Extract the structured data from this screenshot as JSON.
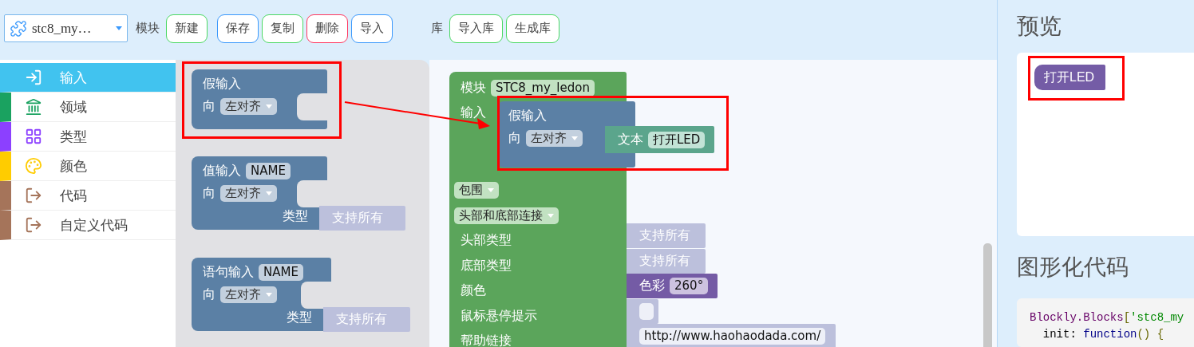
{
  "toolbar": {
    "module_selector": {
      "value": "stc8_my…"
    },
    "module_label": "模块",
    "module_buttons": [
      {
        "label": "新建",
        "color": "#4cd964"
      },
      {
        "label": "保存",
        "color": "#3b99fc"
      },
      {
        "label": "复制",
        "color": "#4cd964"
      },
      {
        "label": "删除",
        "color": "#ff3860"
      },
      {
        "label": "导入",
        "color": "#3b99fc"
      }
    ],
    "library_label": "库",
    "library_buttons": [
      {
        "label": "导入库",
        "color": "#4cd964"
      },
      {
        "label": "生成库",
        "color": "#4cd964"
      }
    ]
  },
  "categories": [
    {
      "label": "输入",
      "color": "#41c3ef",
      "selected": true
    },
    {
      "label": "领域",
      "color": "#1aa260",
      "selected": false
    },
    {
      "label": "类型",
      "color": "#8c40ff",
      "selected": false
    },
    {
      "label": "颜色",
      "color": "#ffcc00",
      "selected": false
    },
    {
      "label": "代码",
      "color": "#a5745a",
      "selected": false
    },
    {
      "label": "自定义代码",
      "color": "#a5745a",
      "selected": false
    }
  ],
  "flyout_blocks": [
    {
      "kind": "dummy",
      "title": "假输入",
      "direction_label": "向",
      "align": "左对齐"
    },
    {
      "kind": "value",
      "title": "值输入",
      "name": "NAME",
      "direction_label": "向",
      "align": "左对齐",
      "type_label": "类型",
      "type_value": "支持所有"
    },
    {
      "kind": "statement",
      "title": "语句输入",
      "name": "NAME",
      "direction_label": "向",
      "align": "左对齐",
      "type_label": "类型",
      "type_value": "支持所有"
    }
  ],
  "factory_block": {
    "title": "模块",
    "name": "STC8_my_ledon",
    "input_label": "输入",
    "input_block": {
      "title": "假输入",
      "direction_label": "向",
      "align": "左对齐",
      "text_block": {
        "label": "文本",
        "value": "打开LED"
      }
    },
    "dropdowns": [
      "包围",
      "头部和底部连接"
    ],
    "rows": [
      {
        "label": "头部类型",
        "kind": "type",
        "value": "支持所有"
      },
      {
        "label": "底部类型",
        "kind": "type",
        "value": "支持所有"
      },
      {
        "label": "颜色",
        "kind": "colour",
        "title": "色彩",
        "value": "260°"
      },
      {
        "label": "鼠标悬停提示",
        "kind": "empty_text"
      },
      {
        "label": "帮助链接",
        "kind": "text",
        "value": "http://www.haohaodada.com/"
      }
    ]
  },
  "preview": {
    "title": "预览",
    "block": "打开LED"
  },
  "code": {
    "title": "图形化代码",
    "lines": [
      [
        {
          "text": "Blockly.Blocks",
          "kind": "type"
        },
        {
          "text": "[",
          "kind": "punct"
        },
        {
          "text": "'stc8_my",
          "kind": "string"
        }
      ],
      [
        {
          "text": "  init",
          "kind": "plain"
        },
        {
          "text": ": ",
          "kind": "plain"
        },
        {
          "text": "function",
          "kind": "keyword"
        },
        {
          "text": "() {",
          "kind": "punct"
        }
      ]
    ]
  }
}
